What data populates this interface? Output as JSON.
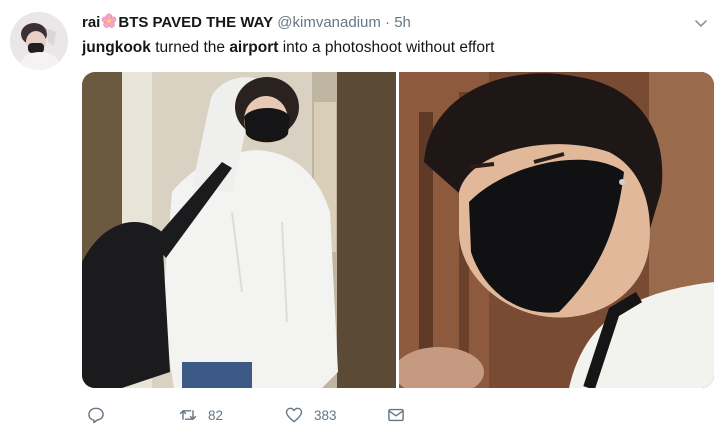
{
  "tweet": {
    "author_prefix": "rai",
    "author_suffix": "BTS PAVED THE WAY",
    "handle": "@kimvanadium",
    "separator": "·",
    "time": "5h",
    "text": {
      "part1": "jungkook",
      "part2": " turned the ",
      "part3": "airport",
      "part4": " into a photoshoot without effort"
    }
  },
  "actions": {
    "retweet_count": "82",
    "like_count": "383"
  },
  "icons": {
    "author_emoji": "cherry-blossom-icon",
    "reply": "reply-icon",
    "retweet": "retweet-icon",
    "like": "heart-icon",
    "dm": "envelope-icon",
    "menu": "chevron-down-icon"
  },
  "colors": {
    "text": "#14171a",
    "muted": "#657786",
    "icon": "#657786",
    "flower": "#f7a6c4"
  }
}
